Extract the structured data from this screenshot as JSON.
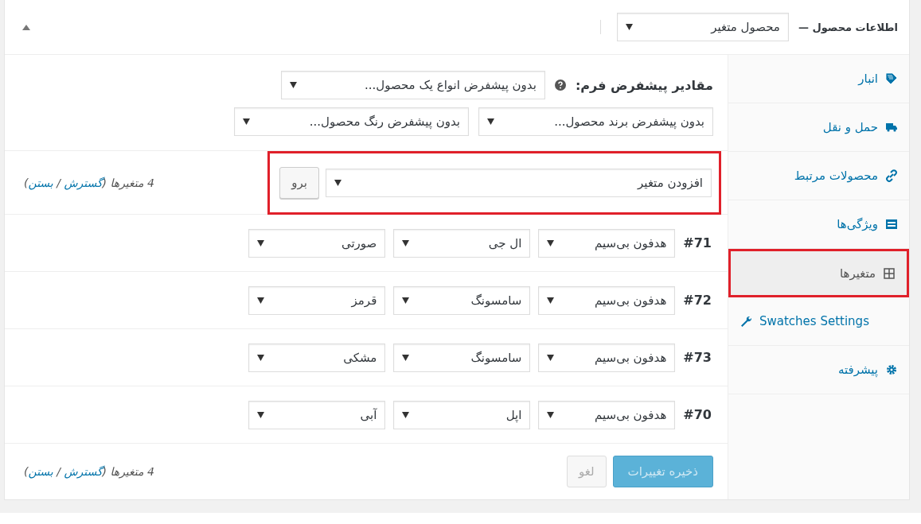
{
  "header": {
    "title": "اطلاعات محصول —",
    "product_type": "محصول متغیر"
  },
  "sidebar": {
    "items": [
      {
        "label": "انبار",
        "selected": false,
        "highlighted": false
      },
      {
        "label": "حمل و نقل",
        "selected": false,
        "highlighted": false
      },
      {
        "label": "محصولات مرتبط",
        "selected": false,
        "highlighted": false
      },
      {
        "label": "ویژگی‌ها",
        "selected": false,
        "highlighted": false
      },
      {
        "label": "متغیرها",
        "selected": true,
        "highlighted": true
      },
      {
        "label": "Swatches Settings",
        "selected": false,
        "highlighted": false
      },
      {
        "label": "پیشرفته",
        "selected": false,
        "highlighted": false
      }
    ]
  },
  "defaults": {
    "label": "مقادیر پیشفرض فرم:",
    "selects": [
      "بدون پیشفرض انواع یک محصول...",
      "بدون پیشفرض برند محصول...",
      "بدون پیشفرض رنگ محصول..."
    ]
  },
  "toolbar": {
    "highlighted": true,
    "action": "افزودن متغیر",
    "go_button": "برو",
    "summary": {
      "prefix": "4 متغیرها (",
      "expand": "گسترش",
      "separator": " / ",
      "collapse": "بستن",
      "suffix": ")"
    }
  },
  "variations": [
    {
      "number": "#71",
      "values": [
        "هدفون بی‌سیم",
        "ال جی",
        "صورتی"
      ]
    },
    {
      "number": "#72",
      "values": [
        "هدفون بی‌سیم",
        "سامسونگ",
        "قرمز"
      ]
    },
    {
      "number": "#73",
      "values": [
        "هدفون بی‌سیم",
        "سامسونگ",
        "مشکی"
      ]
    },
    {
      "number": "#70",
      "values": [
        "هدفون بی‌سیم",
        "اپل",
        "آبی"
      ]
    }
  ],
  "footer": {
    "save_button": {
      "label": "ذخیره تغییرات",
      "disabled": true
    },
    "cancel_button": {
      "label": "لغو",
      "disabled": true
    },
    "summary": {
      "prefix": "4 متغیرها (",
      "expand": "گسترش",
      "separator": " / ",
      "collapse": "بستن",
      "suffix": ")"
    }
  }
}
